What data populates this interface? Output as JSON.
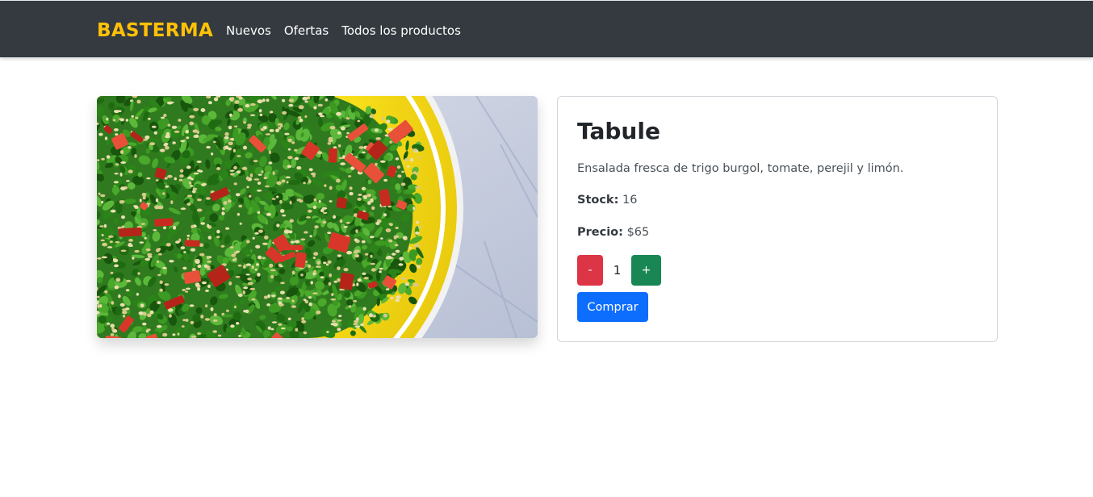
{
  "navbar": {
    "brand": "BASTERMA",
    "links": [
      "Nuevos",
      "Ofertas",
      "Todos los productos"
    ]
  },
  "product": {
    "image_icon": "tabbouleh-salad-photo",
    "title": "Tabule",
    "description": "Ensalada fresca de trigo burgol, tomate, perejil y limón.",
    "stock_label": "Stock:",
    "stock_value": "16",
    "price_label": "Precio:",
    "price_value": "$65"
  },
  "quantity": {
    "decrement_label": "-",
    "value": "1",
    "increment_label": "+"
  },
  "actions": {
    "buy_label": "Comprar"
  },
  "colors": {
    "navbar_bg": "#343a40",
    "brand": "#ffc107",
    "decrement": "#dc3545",
    "increment": "#198754",
    "buy": "#0d6efd"
  }
}
